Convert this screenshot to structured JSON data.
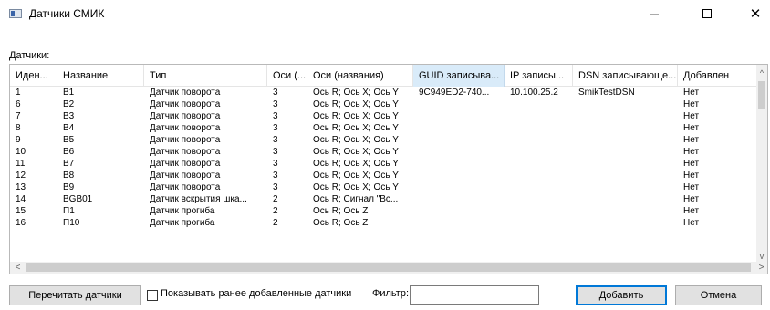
{
  "window": {
    "title": "Датчики СМИК",
    "minimize_glyph": "—",
    "close_glyph": "✕"
  },
  "section_label": "Датчики:",
  "table": {
    "columns": [
      "Иден...",
      "Название",
      "Тип",
      "Оси (...",
      "Оси (названия)",
      "GUID записыва...",
      "IP записы...",
      "DSN записывающе...",
      "Добавлен"
    ],
    "sorted_column": "GUID записыва...",
    "rows": [
      [
        "1",
        "B1",
        "Датчик поворота",
        "3",
        "Ось R; Ось X; Ось Y",
        "9C949ED2-740...",
        "10.100.25.2",
        "SmikTestDSN",
        "Нет"
      ],
      [
        "6",
        "B2",
        "Датчик поворота",
        "3",
        "Ось R; Ось X; Ось Y",
        "",
        "",
        "",
        "Нет"
      ],
      [
        "7",
        "B3",
        "Датчик поворота",
        "3",
        "Ось R; Ось X; Ось Y",
        "",
        "",
        "",
        "Нет"
      ],
      [
        "8",
        "B4",
        "Датчик поворота",
        "3",
        "Ось R; Ось X; Ось Y",
        "",
        "",
        "",
        "Нет"
      ],
      [
        "9",
        "B5",
        "Датчик поворота",
        "3",
        "Ось R; Ось X; Ось Y",
        "",
        "",
        "",
        "Нет"
      ],
      [
        "10",
        "B6",
        "Датчик поворота",
        "3",
        "Ось R; Ось X; Ось Y",
        "",
        "",
        "",
        "Нет"
      ],
      [
        "11",
        "B7",
        "Датчик поворота",
        "3",
        "Ось R; Ось X; Ось Y",
        "",
        "",
        "",
        "Нет"
      ],
      [
        "12",
        "B8",
        "Датчик поворота",
        "3",
        "Ось R; Ось X; Ось Y",
        "",
        "",
        "",
        "Нет"
      ],
      [
        "13",
        "B9",
        "Датчик поворота",
        "3",
        "Ось R; Ось X; Ось Y",
        "",
        "",
        "",
        "Нет"
      ],
      [
        "14",
        "BGB01",
        "Датчик вскрытия шка...",
        "2",
        "Ось R; Сигнал \"Вс...",
        "",
        "",
        "",
        "Нет"
      ],
      [
        "15",
        "П1",
        "Датчик прогиба",
        "2",
        "Ось R; Ось Z",
        "",
        "",
        "",
        "Нет"
      ],
      [
        "16",
        "П10",
        "Датчик прогиба",
        "2",
        "Ось R; Ось Z",
        "",
        "",
        "",
        "Нет"
      ]
    ]
  },
  "scroll_glyphs": {
    "up": "^",
    "down": "v",
    "left": "<",
    "right": ">"
  },
  "buttons": {
    "reread": "Перечитать датчики",
    "add": "Добавить",
    "cancel": "Отмена"
  },
  "show_added_label": "Показывать ранее добавленные датчики",
  "filter": {
    "label": "Фильтр:",
    "value": ""
  },
  "colors": {
    "sorted_header": "#d9ebf9",
    "default_button_border": "#0078d7"
  }
}
